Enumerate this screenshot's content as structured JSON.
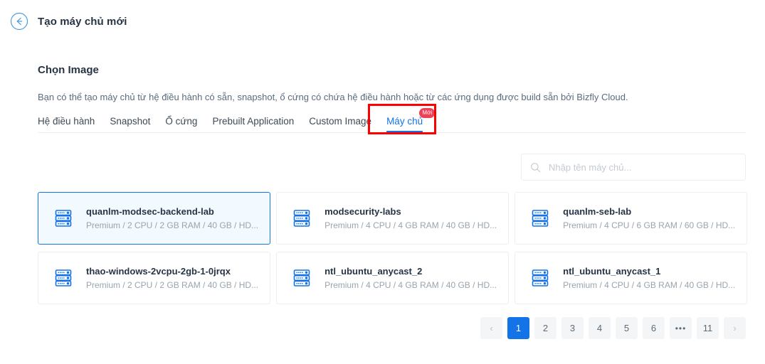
{
  "header": {
    "back_icon": "back-arrow-circle-icon",
    "title": "Tạo máy chủ mới"
  },
  "main": {
    "section_title": "Chọn Image",
    "section_desc": "Bạn có thể tạo máy chủ từ hệ điều hành có sẵn, snapshot, ổ cứng có chứa hệ điều hành hoặc từ các ứng dụng được build sẵn bởi Bizfly Cloud.",
    "tabs": [
      {
        "label": "Hệ điều hành",
        "active": false
      },
      {
        "label": "Snapshot",
        "active": false
      },
      {
        "label": "Ổ cứng",
        "active": false
      },
      {
        "label": "Prebuilt Application",
        "active": false
      },
      {
        "label": "Custom Image",
        "active": false
      },
      {
        "label": "Máy chủ",
        "active": true,
        "badge": "Mới"
      }
    ],
    "search": {
      "icon": "search-icon",
      "placeholder": "Nhập tên máy chủ...",
      "value": ""
    },
    "cards": [
      {
        "name": "quanlm-modsec-backend-lab",
        "specs": "Premium / 2 CPU / 2 GB RAM / 40 GB / HD...",
        "selected": true
      },
      {
        "name": "modsecurity-labs",
        "specs": "Premium / 4 CPU / 4 GB RAM / 40 GB / HD...",
        "selected": false
      },
      {
        "name": "quanlm-seb-lab",
        "specs": "Premium / 4 CPU / 6 GB RAM / 60 GB / HD...",
        "selected": false
      },
      {
        "name": "thao-windows-2vcpu-2gb-1-0jrqx",
        "specs": "Premium / 2 CPU / 2 GB RAM / 40 GB / HD...",
        "selected": false
      },
      {
        "name": "ntl_ubuntu_anycast_2",
        "specs": "Premium / 4 CPU / 4 GB RAM / 40 GB / HD...",
        "selected": false
      },
      {
        "name": "ntl_ubuntu_anycast_1",
        "specs": "Premium / 4 CPU / 4 GB RAM / 40 GB / HD...",
        "selected": false
      }
    ],
    "pagination": {
      "prev_label": "‹",
      "next_label": "›",
      "pages": [
        "1",
        "2",
        "3",
        "4",
        "5",
        "6",
        "•••",
        "11"
      ],
      "current_page": "1"
    }
  },
  "colors": {
    "accent_blue": "#1473e6",
    "badge_red": "#ef4056",
    "annotation_red": "#ff0000",
    "selected_card_bg": "#f2f9ff",
    "border_gray": "#eceef0"
  }
}
